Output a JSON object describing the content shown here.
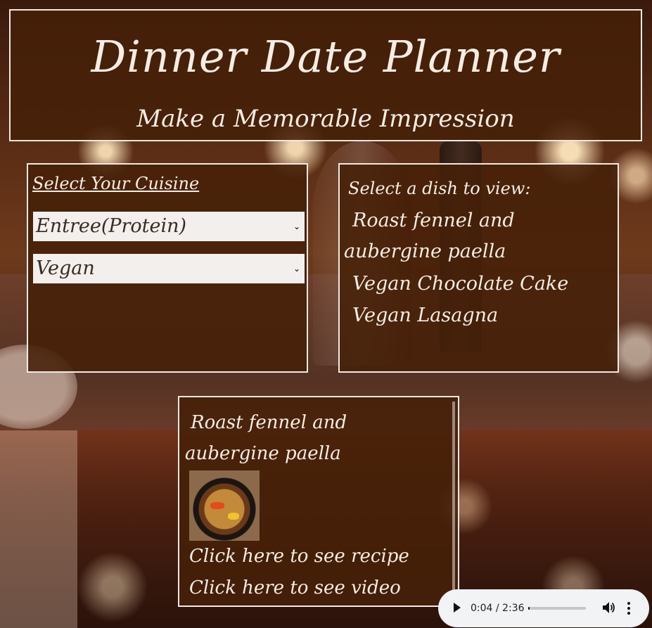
{
  "header": {
    "title": "Dinner Date Planner",
    "subtitle": "Make a Memorable Impression"
  },
  "cuisine": {
    "heading": "Select Your Cuisine",
    "course_select": "Entree(Protein)",
    "diet_select": "Vegan"
  },
  "dish_list": {
    "prompt": "Select a dish to view:",
    "items": [
      "Roast fennel and aubergine paella",
      "Vegan Chocolate Cake",
      "Vegan Lasagna"
    ]
  },
  "detail": {
    "title": "Roast fennel and aubergine paella",
    "recipe_link": "Click here to see recipe",
    "video_link": "Click here to see video"
  },
  "audio": {
    "time": "0:04 / 2:36",
    "progress_fraction": 0.026,
    "icons": {
      "play": "play-icon",
      "volume": "volume-icon",
      "more": "more-options-icon"
    }
  }
}
